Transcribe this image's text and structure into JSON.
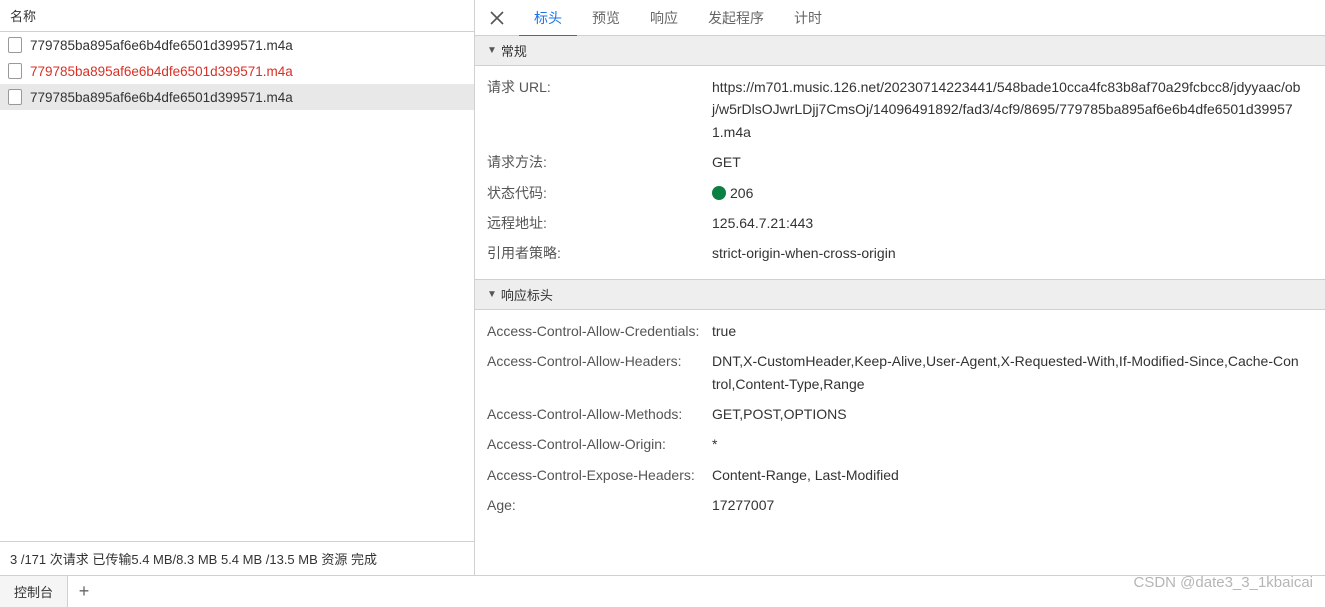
{
  "left": {
    "header": "名称",
    "items": [
      {
        "name": "779785ba895af6e6b4dfe6501d399571.m4a",
        "error": false,
        "selected": false
      },
      {
        "name": "779785ba895af6e6b4dfe6501d399571.m4a",
        "error": true,
        "selected": false
      },
      {
        "name": "779785ba895af6e6b4dfe6501d399571.m4a",
        "error": false,
        "selected": true
      }
    ],
    "status": "3 /171 次请求  已传输5.4 MB/8.3 MB  5.4 MB /13.5 MB 资源  完成"
  },
  "tabs": {
    "close_icon": "close-icon",
    "items": [
      "标头",
      "预览",
      "响应",
      "发起程序",
      "计时"
    ],
    "active_index": 0
  },
  "general": {
    "title": "常规",
    "rows": [
      {
        "key": "请求 URL:",
        "value": "https://m701.music.126.net/20230714223441/548bade10cca4fc83b8af70a29fcbcc8/jdyyaac/obj/w5rDlsOJwrLDjj7CmsOj/14096491892/fad3/4cf9/8695/779785ba895af6e6b4dfe6501d399571.m4a"
      },
      {
        "key": "请求方法:",
        "value": "GET"
      },
      {
        "key": "状态代码:",
        "value": "206",
        "status_dot": true
      },
      {
        "key": "远程地址:",
        "value": "125.64.7.21:443"
      },
      {
        "key": "引用者策略:",
        "value": "strict-origin-when-cross-origin"
      }
    ]
  },
  "response_headers": {
    "title": "响应标头",
    "rows": [
      {
        "key": "Access-Control-Allow-Credentials:",
        "value": "true"
      },
      {
        "key": "Access-Control-Allow-Headers:",
        "value": "DNT,X-CustomHeader,Keep-Alive,User-Agent,X-Requested-With,If-Modified-Since,Cache-Control,Content-Type,Range"
      },
      {
        "key": "Access-Control-Allow-Methods:",
        "value": "GET,POST,OPTIONS"
      },
      {
        "key": "Access-Control-Allow-Origin:",
        "value": "*"
      },
      {
        "key": "Access-Control-Expose-Headers:",
        "value": "Content-Range, Last-Modified"
      },
      {
        "key": "Age:",
        "value": "17277007"
      }
    ]
  },
  "bottom": {
    "console_tab": "控制台",
    "add": "+"
  },
  "watermark": "CSDN @date3_3_1kbaicai"
}
